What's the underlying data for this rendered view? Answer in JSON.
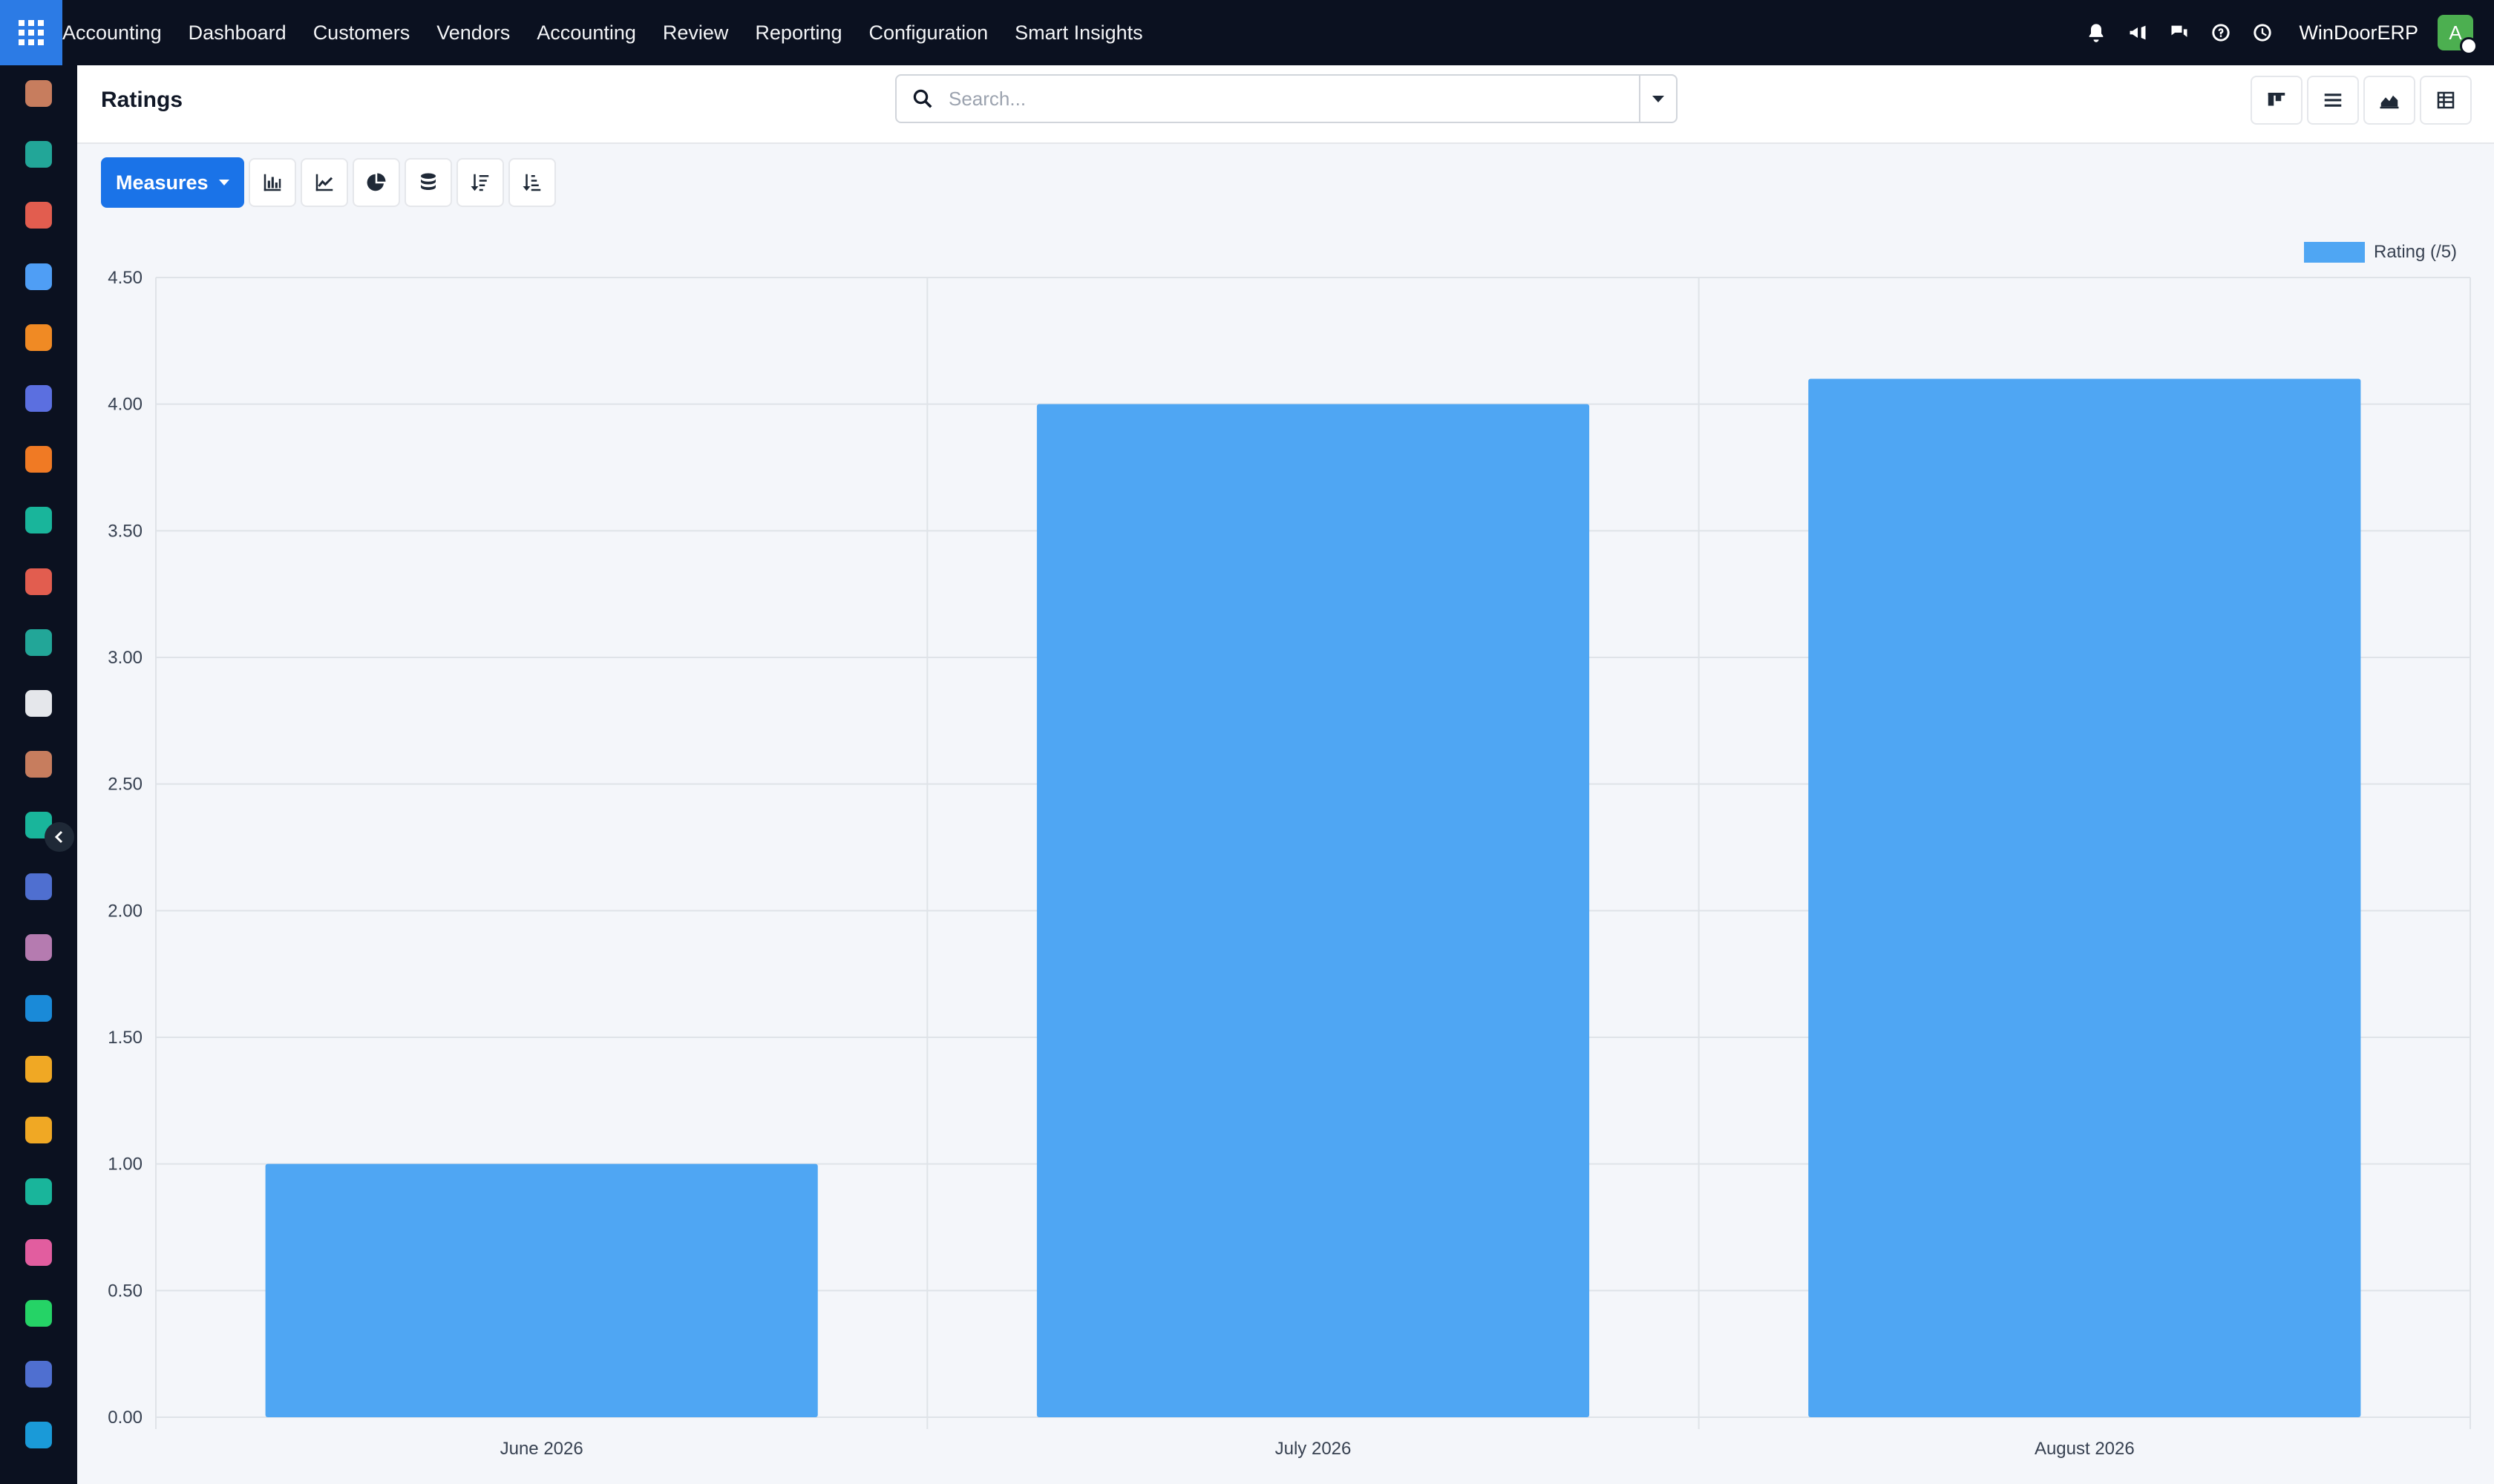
{
  "navbar": {
    "brand": "Accounting",
    "menu": [
      "Dashboard",
      "Customers",
      "Vendors",
      "Accounting",
      "Review",
      "Reporting",
      "Configuration",
      "Smart Insights"
    ],
    "company": "WinDoorERP",
    "avatar_letter": "A",
    "icons": [
      "bell-icon",
      "megaphone-icon",
      "chat-icon",
      "help-icon",
      "clock-icon"
    ]
  },
  "sidebar": {
    "apps": [
      {
        "icon": "app-icon-1",
        "color": "#c77d5e"
      },
      {
        "icon": "contacts-icon",
        "color": "#22a698"
      },
      {
        "icon": "bar-chart-app-icon",
        "color": "#e25d4f"
      },
      {
        "icon": "pie-app-icon",
        "color": "#4f9ef5"
      },
      {
        "icon": "chat-bubble-icon",
        "color": "#f08a24"
      },
      {
        "icon": "mail-app-icon",
        "color": "#5b6fe0"
      },
      {
        "icon": "livechat-icon",
        "color": "#f07a24"
      },
      {
        "icon": "sign-app-icon",
        "color": "#19b59b"
      },
      {
        "icon": "stats-app-icon",
        "color": "#e25d4f"
      },
      {
        "icon": "employees-icon",
        "color": "#22a698"
      },
      {
        "icon": "inventory-icon",
        "color": "#e5e7eb"
      },
      {
        "icon": "app-icon-2",
        "color": "#c77d5e"
      },
      {
        "icon": "check-app-icon",
        "color": "#19b59b"
      },
      {
        "icon": "knowledge-icon",
        "color": "#4f6fd0"
      },
      {
        "icon": "box-app-icon",
        "color": "#b57bb0"
      },
      {
        "icon": "invoice-app-icon",
        "color": "#1a8ad8"
      },
      {
        "icon": "team-app-icon",
        "color": "#f0a824"
      },
      {
        "icon": "calendar-app-icon",
        "color": "#f0a824"
      },
      {
        "icon": "pen-app-icon",
        "color": "#19b59b"
      },
      {
        "icon": "dashboard-app-icon",
        "color": "#e25d9f"
      },
      {
        "icon": "whatsapp-icon",
        "color": "#25d366"
      },
      {
        "icon": "timer-app-icon",
        "color": "#4f6fd0"
      },
      {
        "icon": "discuss-app-icon",
        "color": "#1a9ad8"
      }
    ]
  },
  "control_panel": {
    "title": "Ratings",
    "search_placeholder": "Search...",
    "views": [
      "kanban-view-icon",
      "list-view-icon",
      "graph-view-icon",
      "pivot-view-icon"
    ]
  },
  "toolbar": {
    "measures_label": "Measures",
    "tools": [
      "bar-chart-icon",
      "line-chart-icon",
      "pie-chart-icon",
      "stacked-icon",
      "sort-descending-icon",
      "sort-ascending-icon"
    ]
  },
  "chart_data": {
    "type": "bar",
    "categories": [
      "June 2026",
      "July 2026",
      "August 2026"
    ],
    "series": [
      {
        "name": "Rating (/5)",
        "values": [
          1.0,
          4.0,
          4.1
        ],
        "color": "#4fa6f3"
      }
    ],
    "ylim": [
      0,
      4.5
    ],
    "yticks": [
      "0.00",
      "0.50",
      "1.00",
      "1.50",
      "2.00",
      "2.50",
      "3.00",
      "3.50",
      "4.00",
      "4.50"
    ],
    "grid": true,
    "legend": "top-right"
  }
}
